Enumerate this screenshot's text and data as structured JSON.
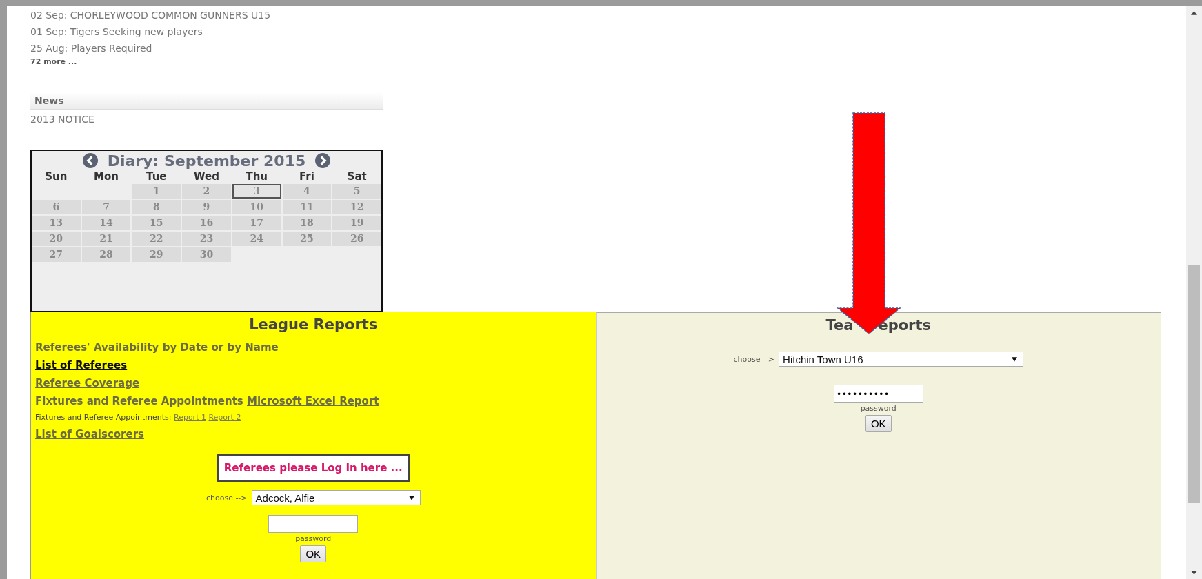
{
  "news_feed": {
    "items": [
      "02 Sep: CHORLEYWOOD COMMON GUNNERS U15",
      "01 Sep: Tigers Seeking new players",
      "25 Aug: Players Required"
    ],
    "more": "72 more ..."
  },
  "news": {
    "title": "News",
    "items": [
      "2013 NOTICE"
    ]
  },
  "diary": {
    "title": "Diary: September 2015",
    "weekdays": [
      "Sun",
      "Mon",
      "Tue",
      "Wed",
      "Thu",
      "Fri",
      "Sat"
    ],
    "weeks": [
      [
        {
          "kind": "blank"
        },
        {
          "kind": "blank"
        },
        {
          "label": "1",
          "selected": false
        },
        {
          "label": "2",
          "selected": false
        },
        {
          "label": "3",
          "selected": true
        },
        {
          "label": "4",
          "selected": false
        },
        {
          "label": "5",
          "selected": false
        }
      ],
      [
        {
          "label": "6",
          "selected": false
        },
        {
          "label": "7",
          "selected": false
        },
        {
          "label": "8",
          "selected": false
        },
        {
          "label": "9",
          "selected": false
        },
        {
          "label": "10",
          "selected": false
        },
        {
          "label": "11",
          "selected": false
        },
        {
          "label": "12",
          "selected": false
        }
      ],
      [
        {
          "label": "13",
          "selected": false
        },
        {
          "label": "14",
          "selected": false
        },
        {
          "label": "15",
          "selected": false
        },
        {
          "label": "16",
          "selected": false
        },
        {
          "label": "17",
          "selected": false
        },
        {
          "label": "18",
          "selected": false
        },
        {
          "label": "19",
          "selected": false
        }
      ],
      [
        {
          "label": "20",
          "selected": false
        },
        {
          "label": "21",
          "selected": false
        },
        {
          "label": "22",
          "selected": false
        },
        {
          "label": "23",
          "selected": false
        },
        {
          "label": "24",
          "selected": false
        },
        {
          "label": "25",
          "selected": false
        },
        {
          "label": "26",
          "selected": false
        }
      ],
      [
        {
          "label": "27",
          "selected": false
        },
        {
          "label": "28",
          "selected": false
        },
        {
          "label": "29",
          "selected": false
        },
        {
          "label": "30",
          "selected": false
        }
      ]
    ]
  },
  "league_reports": {
    "title": "League Reports",
    "lines": [
      {
        "kind": "large",
        "parts": [
          {
            "kind": "text",
            "text": "Referees' Availability"
          },
          {
            "kind": "link",
            "text": "by Date"
          },
          {
            "kind": "text",
            "text": "or"
          },
          {
            "kind": "link",
            "text": "by Name"
          }
        ]
      },
      {
        "kind": "large",
        "parts": [
          {
            "kind": "active_link",
            "text": "List of Referees"
          }
        ]
      },
      {
        "kind": "large",
        "parts": [
          {
            "kind": "link",
            "text": "Referee Coverage"
          }
        ]
      },
      {
        "kind": "large",
        "parts": [
          {
            "kind": "text",
            "text": "Fixtures and Referee Appointments"
          },
          {
            "kind": "link",
            "text": "Microsoft Excel Report"
          }
        ]
      },
      {
        "kind": "small",
        "parts": [
          {
            "kind": "text",
            "text": "Fixtures and Referee Appointments:"
          },
          {
            "kind": "link",
            "text": "Report 1"
          },
          {
            "kind": "link",
            "text": "Report 2"
          }
        ]
      },
      {
        "kind": "large",
        "parts": [
          {
            "kind": "link",
            "text": "List of Goalscorers"
          }
        ]
      }
    ],
    "login_banner": "Referees please Log In here ...",
    "choose_label": "choose -->",
    "select_value": "Adcock, Alfie",
    "password_label": "password",
    "ok_button": "OK"
  },
  "team_reports": {
    "title_parts": [
      "Tea",
      "eports"
    ],
    "choose_label": "choose -->",
    "select_value": "Hitchin Town U16",
    "password_value": "••••••••••",
    "password_label": "password",
    "ok_button": "OK"
  }
}
